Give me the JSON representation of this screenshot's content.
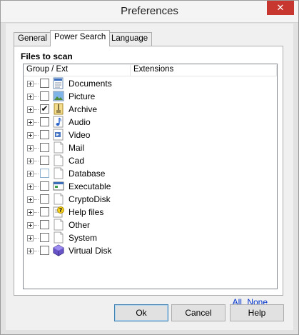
{
  "window": {
    "title": "Preferences",
    "close_glyph": "✕"
  },
  "tabs": [
    {
      "label": "General",
      "active": false
    },
    {
      "label": "Power Search",
      "active": true
    },
    {
      "label": "Language",
      "active": false
    }
  ],
  "panel": {
    "group_title": "Files to scan",
    "columns": [
      "Group / Ext",
      "Extensions"
    ],
    "items": [
      {
        "label": "Documents",
        "checked": false,
        "icon": "documents-icon"
      },
      {
        "label": "Picture",
        "checked": false,
        "icon": "picture-icon"
      },
      {
        "label": "Archive",
        "checked": true,
        "icon": "archive-icon"
      },
      {
        "label": "Audio",
        "checked": false,
        "icon": "audio-icon"
      },
      {
        "label": "Video",
        "checked": false,
        "icon": "video-icon"
      },
      {
        "label": "Mail",
        "checked": false,
        "icon": "mail-icon"
      },
      {
        "label": "Cad",
        "checked": false,
        "icon": "cad-icon"
      },
      {
        "label": "Database",
        "checked": false,
        "icon": "database-icon"
      },
      {
        "label": "Executable",
        "checked": false,
        "icon": "executable-icon"
      },
      {
        "label": "CryptoDisk",
        "checked": false,
        "icon": "cryptodisk-icon"
      },
      {
        "label": "Help files",
        "checked": false,
        "icon": "help-files-icon"
      },
      {
        "label": "Other",
        "checked": false,
        "icon": "other-icon"
      },
      {
        "label": "System",
        "checked": false,
        "icon": "system-icon"
      },
      {
        "label": "Virtual Disk",
        "checked": false,
        "icon": "virtual-disk-icon"
      }
    ],
    "links": {
      "all": "All",
      "none": "None"
    }
  },
  "buttons": {
    "ok": "Ok",
    "cancel": "Cancel",
    "help": "Help"
  },
  "colors": {
    "accent_link": "#0033cc",
    "close_button": "#c7372f"
  }
}
